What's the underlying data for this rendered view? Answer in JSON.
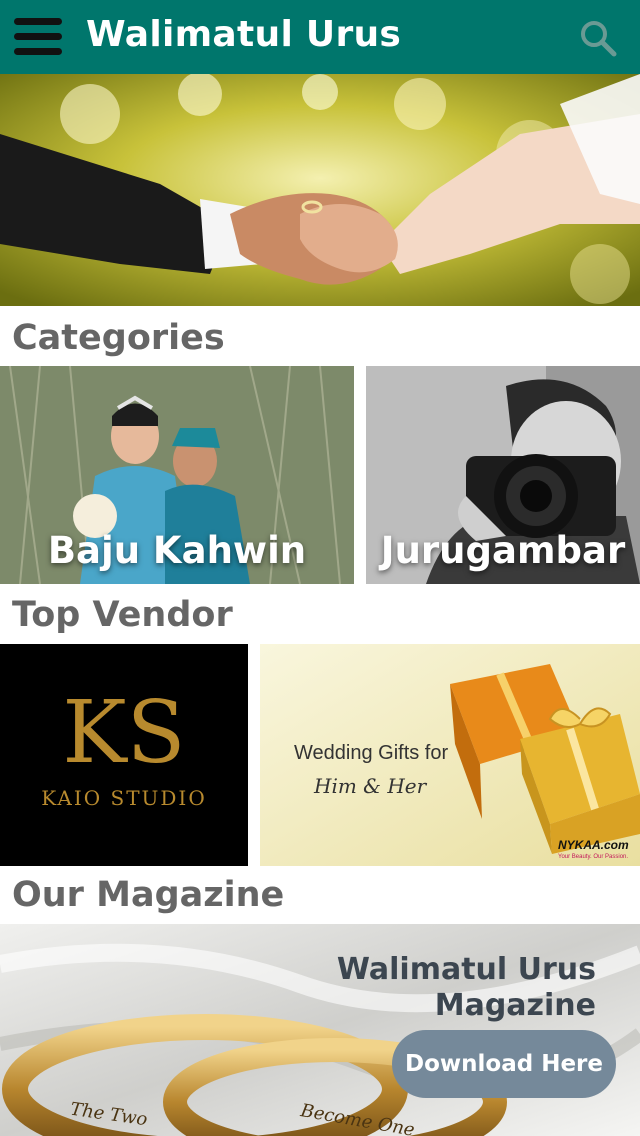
{
  "header": {
    "title": "Walimatul Urus",
    "menu_icon": "hamburger-icon",
    "search_icon": "search-icon",
    "bar_color": "#00766c"
  },
  "sections": {
    "categories": "Categories",
    "top_vendor": "Top Vendor",
    "magazine": "Our Magazine"
  },
  "categories": [
    {
      "label": "Baju Kahwin"
    },
    {
      "label": "Jurugambar"
    }
  ],
  "vendors": [
    {
      "logo_text": "KAIO STUDIO",
      "monogram": "KS"
    },
    {
      "headline": "Wedding Gifts for",
      "subline": "Him & Her",
      "brand": "NYKAA.com",
      "tagline": "Your Beauty. Our Passion."
    }
  ],
  "magazine": {
    "title_line1": "Walimatul Urus",
    "title_line2": "Magazine",
    "download_label": "Download Here",
    "ring_engraving_1": "The Two",
    "ring_engraving_2": "Become One"
  }
}
